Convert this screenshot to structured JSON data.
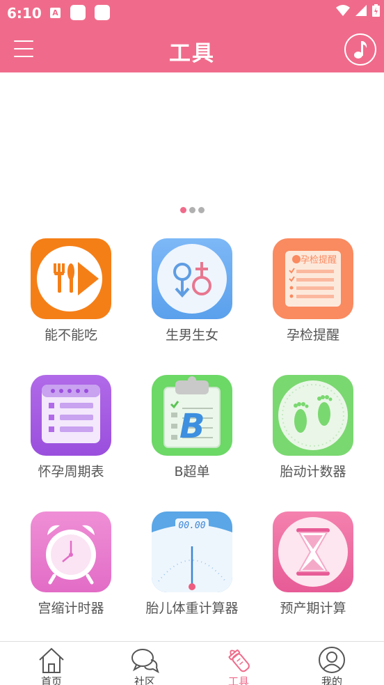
{
  "status": {
    "time": "6:10",
    "notif_a": "A"
  },
  "app_bar": {
    "title": "工具"
  },
  "carousel": {
    "dots": 3,
    "active_index": 0
  },
  "tools": [
    {
      "label": "能不能吃",
      "icon": "fork-knife-play-icon"
    },
    {
      "label": "生男生女",
      "icon": "gender-symbols-icon"
    },
    {
      "label": "孕检提醒",
      "icon": "checkup-reminder-icon",
      "icon_text": "孕检提醒"
    },
    {
      "label": "怀孕周期表",
      "icon": "calendar-list-icon"
    },
    {
      "label": "B超单",
      "icon": "clipboard-b-icon",
      "icon_text": "B"
    },
    {
      "label": "胎动计数器",
      "icon": "footprints-icon"
    },
    {
      "label": "宫缩计时器",
      "icon": "alarm-clock-icon"
    },
    {
      "label": "胎儿体重计算器",
      "icon": "scale-icon",
      "icon_text": "00.00"
    },
    {
      "label": "预产期计算",
      "icon": "hourglass-icon"
    }
  ],
  "tab_bar": {
    "items": [
      {
        "label": "首页",
        "icon": "home-icon"
      },
      {
        "label": "社区",
        "icon": "chat-bubbles-icon"
      },
      {
        "label": "工具",
        "icon": "baby-bottle-icon",
        "active": true
      },
      {
        "label": "我的",
        "icon": "user-icon"
      }
    ]
  },
  "colors": {
    "brand": "#f06b8b"
  }
}
